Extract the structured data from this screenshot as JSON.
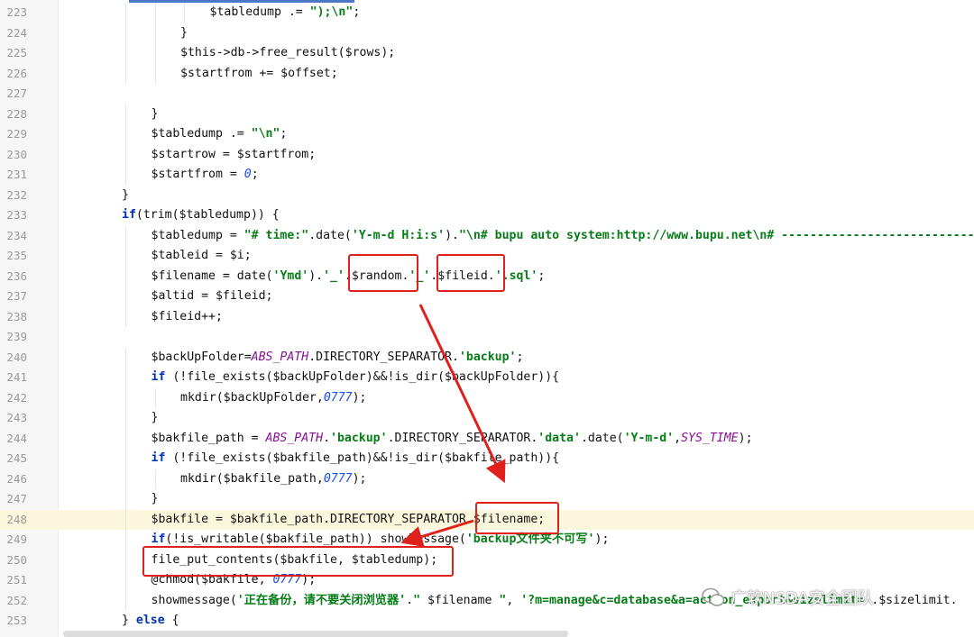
{
  "editor": {
    "lines": [
      {
        "no": "223",
        "indent": 5,
        "tokens": [
          [
            "var",
            "$tabledump"
          ],
          [
            "txt",
            " .= "
          ],
          [
            "str",
            "\");\\n\""
          ],
          [
            "txt",
            ";"
          ]
        ]
      },
      {
        "no": "224",
        "indent": 4,
        "tokens": [
          [
            "txt",
            "}"
          ]
        ]
      },
      {
        "no": "225",
        "indent": 4,
        "tokens": [
          [
            "var",
            "$this"
          ],
          [
            "txt",
            "->db->free_result("
          ],
          [
            "var",
            "$rows"
          ],
          [
            "txt",
            ");"
          ]
        ]
      },
      {
        "no": "226",
        "indent": 4,
        "tokens": [
          [
            "var",
            "$startfrom"
          ],
          [
            "txt",
            " += "
          ],
          [
            "var",
            "$offset"
          ],
          [
            "txt",
            ";"
          ]
        ]
      },
      {
        "no": "227",
        "indent": 0,
        "tokens": []
      },
      {
        "no": "228",
        "indent": 3,
        "tokens": [
          [
            "txt",
            "}"
          ]
        ]
      },
      {
        "no": "229",
        "indent": 3,
        "tokens": [
          [
            "var",
            "$tabledump"
          ],
          [
            "txt",
            " .= "
          ],
          [
            "str",
            "\"\\n\""
          ],
          [
            "txt",
            ";"
          ]
        ]
      },
      {
        "no": "230",
        "indent": 3,
        "tokens": [
          [
            "var",
            "$startrow"
          ],
          [
            "txt",
            " = "
          ],
          [
            "var",
            "$startfrom"
          ],
          [
            "txt",
            ";"
          ]
        ]
      },
      {
        "no": "231",
        "indent": 3,
        "tokens": [
          [
            "var",
            "$startfrom"
          ],
          [
            "txt",
            " = "
          ],
          [
            "num",
            "0"
          ],
          [
            "txt",
            ";"
          ]
        ]
      },
      {
        "no": "232",
        "indent": 2,
        "tokens": [
          [
            "txt",
            "}"
          ]
        ]
      },
      {
        "no": "233",
        "indent": 2,
        "tokens": [
          [
            "kw",
            "if"
          ],
          [
            "txt",
            "(trim("
          ],
          [
            "var",
            "$tabledump"
          ],
          [
            "txt",
            ")) {"
          ]
        ]
      },
      {
        "no": "234",
        "indent": 3,
        "tokens": [
          [
            "var",
            "$tabledump"
          ],
          [
            "txt",
            " = "
          ],
          [
            "str",
            "\"# time:\""
          ],
          [
            "txt",
            ".date("
          ],
          [
            "str",
            "'Y-m-d H:i:s'"
          ],
          [
            "txt",
            ")."
          ],
          [
            "str",
            "\"\\n# bupu auto system:http://www.bupu.net\\n# ------------------------------"
          ]
        ]
      },
      {
        "no": "235",
        "indent": 3,
        "tokens": [
          [
            "var",
            "$tableid"
          ],
          [
            "txt",
            " = "
          ],
          [
            "var",
            "$i"
          ],
          [
            "txt",
            ";"
          ]
        ]
      },
      {
        "no": "236",
        "indent": 3,
        "tokens": [
          [
            "var",
            "$filename"
          ],
          [
            "txt",
            " = date("
          ],
          [
            "str",
            "'Ymd'"
          ],
          [
            "txt",
            ")."
          ],
          [
            "str",
            "'_'"
          ],
          [
            "txt",
            "."
          ],
          [
            "var",
            "$random"
          ],
          [
            "txt",
            "."
          ],
          [
            "str",
            "'_'"
          ],
          [
            "txt",
            "."
          ],
          [
            "var",
            "$fileid"
          ],
          [
            "txt",
            "."
          ],
          [
            "str",
            "'.sql'"
          ],
          [
            "txt",
            ";"
          ]
        ]
      },
      {
        "no": "237",
        "indent": 3,
        "tokens": [
          [
            "var",
            "$altid"
          ],
          [
            "txt",
            " = "
          ],
          [
            "var",
            "$fileid"
          ],
          [
            "txt",
            ";"
          ]
        ]
      },
      {
        "no": "238",
        "indent": 3,
        "tokens": [
          [
            "var",
            "$fileid"
          ],
          [
            "txt",
            "++;"
          ]
        ]
      },
      {
        "no": "239",
        "indent": 0,
        "tokens": []
      },
      {
        "no": "240",
        "indent": 3,
        "tokens": [
          [
            "var",
            "$backUpFolder"
          ],
          [
            "txt",
            "="
          ],
          [
            "const",
            "ABS_PATH"
          ],
          [
            "txt",
            ".DIRECTORY_SEPARATOR."
          ],
          [
            "str",
            "'backup'"
          ],
          [
            "txt",
            ";"
          ]
        ]
      },
      {
        "no": "241",
        "indent": 3,
        "tokens": [
          [
            "kw",
            "if"
          ],
          [
            "txt",
            " (!file_exists("
          ],
          [
            "var",
            "$backUpFolder"
          ],
          [
            "txt",
            ")&&!is_dir("
          ],
          [
            "var",
            "$backUpFolder"
          ],
          [
            "txt",
            ")){"
          ]
        ]
      },
      {
        "no": "242",
        "indent": 4,
        "tokens": [
          [
            "txt",
            "mkdir("
          ],
          [
            "var",
            "$backUpFolder"
          ],
          [
            "txt",
            ","
          ],
          [
            "num",
            "0777"
          ],
          [
            "txt",
            ");"
          ]
        ]
      },
      {
        "no": "243",
        "indent": 3,
        "tokens": [
          [
            "txt",
            "}"
          ]
        ]
      },
      {
        "no": "244",
        "indent": 3,
        "tokens": [
          [
            "var",
            "$bakfile_path"
          ],
          [
            "txt",
            " = "
          ],
          [
            "const",
            "ABS_PATH"
          ],
          [
            "txt",
            "."
          ],
          [
            "str",
            "'backup'"
          ],
          [
            "txt",
            ".DIRECTORY_SEPARATOR."
          ],
          [
            "str",
            "'data'"
          ],
          [
            "txt",
            ".date("
          ],
          [
            "str",
            "'Y-m-d'"
          ],
          [
            "txt",
            ","
          ],
          [
            "const",
            "SYS_TIME"
          ],
          [
            "txt",
            ");"
          ]
        ]
      },
      {
        "no": "245",
        "indent": 3,
        "tokens": [
          [
            "kw",
            "if"
          ],
          [
            "txt",
            " (!file_exists("
          ],
          [
            "var",
            "$bakfile_path"
          ],
          [
            "txt",
            ")&&!is_dir("
          ],
          [
            "var",
            "$bakfile_path"
          ],
          [
            "txt",
            ")){"
          ]
        ]
      },
      {
        "no": "246",
        "indent": 4,
        "tokens": [
          [
            "txt",
            "mkdir("
          ],
          [
            "var",
            "$bakfile_path"
          ],
          [
            "txt",
            ","
          ],
          [
            "num",
            "0777"
          ],
          [
            "txt",
            ");"
          ]
        ]
      },
      {
        "no": "247",
        "indent": 3,
        "tokens": [
          [
            "txt",
            "}"
          ]
        ]
      },
      {
        "no": "248",
        "indent": 3,
        "hl": true,
        "tokens": [
          [
            "var",
            "$bakfile"
          ],
          [
            "txt",
            " = "
          ],
          [
            "var",
            "$bakfile_path"
          ],
          [
            "txt",
            ".DIRECTORY_SEPARATOR."
          ],
          [
            "var",
            "$filename"
          ],
          [
            "txt",
            ";"
          ]
        ]
      },
      {
        "no": "249",
        "indent": 3,
        "tokens": [
          [
            "kw",
            "if"
          ],
          [
            "txt",
            "(!is_writable("
          ],
          [
            "var",
            "$bakfile_path"
          ],
          [
            "txt",
            ")) showMessage("
          ],
          [
            "str",
            "'backup文件夹不可写'"
          ],
          [
            "txt",
            ");"
          ]
        ]
      },
      {
        "no": "250",
        "indent": 3,
        "tokens": [
          [
            "txt",
            "file_put_contents("
          ],
          [
            "var",
            "$bakfile"
          ],
          [
            "txt",
            ", "
          ],
          [
            "var",
            "$tabledump"
          ],
          [
            "txt",
            ");"
          ]
        ]
      },
      {
        "no": "251",
        "indent": 3,
        "tokens": [
          [
            "txt",
            "@chmod("
          ],
          [
            "var",
            "$bakfile"
          ],
          [
            "txt",
            ", "
          ],
          [
            "num",
            "0777"
          ],
          [
            "txt",
            ");"
          ]
        ]
      },
      {
        "no": "252",
        "indent": 3,
        "tokens": [
          [
            "txt",
            "showmessage("
          ],
          [
            "str",
            "'正在备份，请不要关闭浏览器'"
          ],
          [
            "txt",
            "."
          ],
          [
            "str",
            "\" "
          ],
          [
            "var",
            "$filename"
          ],
          [
            "str",
            " \""
          ],
          [
            "txt",
            ", "
          ],
          [
            "str",
            "'?m=manage&c=database&a=action_export&sizelimit='"
          ],
          [
            "txt",
            ".$sizelimit."
          ]
        ]
      },
      {
        "no": "253",
        "indent": 2,
        "tokens": [
          [
            "txt",
            "} "
          ],
          [
            "kw",
            "else"
          ],
          [
            "txt",
            " {"
          ]
        ]
      }
    ]
  },
  "watermark": {
    "text": "广软NSDA安全团队"
  }
}
